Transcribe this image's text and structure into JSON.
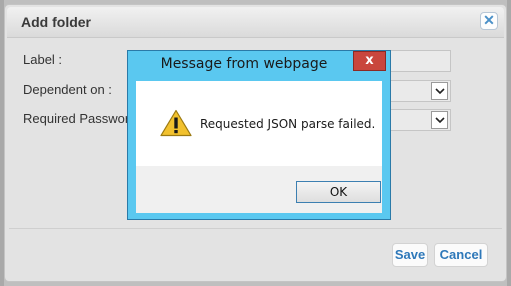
{
  "dialog": {
    "title": "Add folder",
    "close_icon": "close-icon",
    "fields": [
      {
        "label": "Label :",
        "value": ""
      },
      {
        "label": "Dependent on :",
        "value": ""
      },
      {
        "label": "Required Passwor",
        "value": ""
      }
    ],
    "buttons": {
      "save": "Save",
      "cancel": "Cancel"
    },
    "accent_color": "#2e78b9"
  },
  "alert": {
    "title": "Message from webpage",
    "close_glyph": "x",
    "icon": "warning-icon",
    "message": "Requested JSON parse failed.",
    "ok_label": "OK",
    "titlebar_color": "#5ac8f0",
    "close_color": "#c9463d"
  }
}
